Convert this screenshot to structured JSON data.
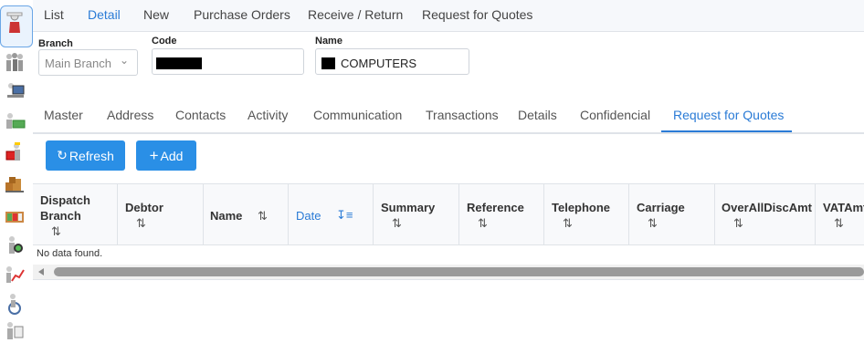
{
  "top_menu": {
    "items": [
      "List",
      "Detail",
      "New",
      "Purchase Orders",
      "Receive / Return",
      "Request for Quotes"
    ],
    "active": "Detail"
  },
  "header": {
    "branch": {
      "label": "Branch",
      "value": "Main Branch"
    },
    "code": {
      "label": "Code",
      "value": ""
    },
    "name": {
      "label": "Name",
      "value": "COMPUTERS"
    }
  },
  "tabs": {
    "items": [
      "Master",
      "Address",
      "Contacts",
      "Activity",
      "Communication",
      "Transactions",
      "Details",
      "Confidencial",
      "Request for Quotes"
    ],
    "active": "Request for Quotes"
  },
  "toolbar": {
    "refresh_label": "Refresh",
    "add_label": "Add"
  },
  "grid": {
    "columns": [
      {
        "title_line1": "Dispatch",
        "title_line2": "Branch"
      },
      {
        "title": "Debtor"
      },
      {
        "title": "Name"
      },
      {
        "title": "Date"
      },
      {
        "title": "Summary"
      },
      {
        "title": "Reference"
      },
      {
        "title": "Telephone"
      },
      {
        "title": "Carriage"
      },
      {
        "title": "OverAllDiscAmt"
      },
      {
        "title": "VATAmt"
      }
    ],
    "sorted_column": "Date",
    "empty_message": "No data found."
  },
  "icons": {
    "rail": [
      "user-icon",
      "people-icon",
      "computer-user-icon",
      "money-icon",
      "gift-icon",
      "truck-icon",
      "inventory-icon",
      "search-user-icon",
      "chart-user-icon",
      "wheelchair-icon",
      "report-icon"
    ],
    "accent_color": "#2a7bd6",
    "button_color": "#2a8fe6"
  }
}
